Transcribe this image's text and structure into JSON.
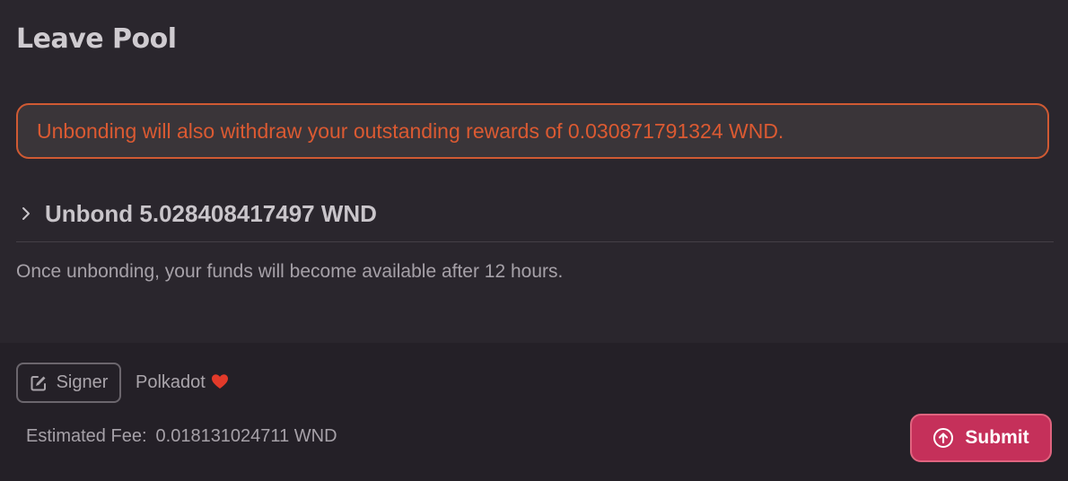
{
  "modal": {
    "title": "Leave Pool"
  },
  "warning": {
    "text": "Unbonding will also withdraw your outstanding rewards of 0.030871791324 WND."
  },
  "unbond": {
    "label": "Unbond 5.028408417497 WND",
    "note": "Once unbonding, your funds will become available after 12 hours."
  },
  "footer": {
    "signer_button_label": "Signer",
    "signer_name": "Polkadot",
    "fee_label": "Estimated Fee:",
    "fee_value": "0.018131024711 WND",
    "submit_label": "Submit"
  },
  "icons": {
    "chevron": "chevron-right-icon",
    "signer": "edit-icon",
    "heart": "heart-icon",
    "submit": "arrow-up-circle-icon"
  },
  "colors": {
    "warning": "#db5a32",
    "accent": "#c5305a",
    "heart": "#e23a2a"
  }
}
